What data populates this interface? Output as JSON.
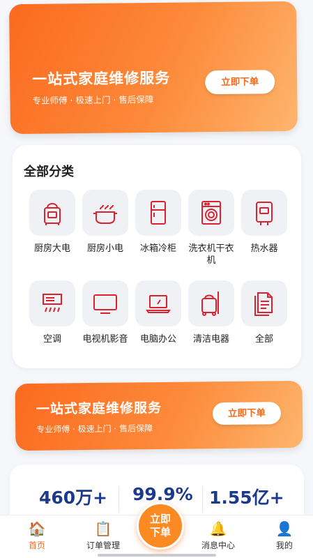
{
  "banner_top": {
    "title": "一站式家庭维修服务",
    "subtitle": "专业师傅 · 极速上门 · 售后保障",
    "button": "立即下单"
  },
  "categories": {
    "title": "全部分类",
    "items": [
      {
        "label": "厨房大电",
        "icon": "kitchen-appliance-icon"
      },
      {
        "label": "厨房小电",
        "icon": "cooking-pot-icon"
      },
      {
        "label": "冰箱冷柜",
        "icon": "refrigerator-icon"
      },
      {
        "label": "洗衣机干衣机",
        "icon": "washing-machine-icon"
      },
      {
        "label": "热水器",
        "icon": "water-heater-icon"
      },
      {
        "label": "空调",
        "icon": "air-conditioner-icon"
      },
      {
        "label": "电视机影音",
        "icon": "television-icon"
      },
      {
        "label": "电脑办公",
        "icon": "laptop-icon"
      },
      {
        "label": "清洁电器",
        "icon": "cleaning-appliance-icon"
      },
      {
        "label": "全部",
        "icon": "all-documents-icon"
      }
    ]
  },
  "banner_mid": {
    "title": "一站式家庭维修服务",
    "subtitle": "专业师傅 · 极速上门 · 售后保障",
    "button": "立即下单"
  },
  "stats": {
    "values": [
      "460万+",
      "99.9%",
      "1.55亿+"
    ]
  },
  "tabbar": {
    "items": [
      {
        "label": "首页",
        "icon": "home-icon",
        "active": true
      },
      {
        "label": "订单管理",
        "icon": "clipboard-icon",
        "active": false
      },
      {
        "label": "消息中心",
        "icon": "bell-icon",
        "active": false
      },
      {
        "label": "我的",
        "icon": "user-icon",
        "active": false
      }
    ],
    "fab_line1": "立即",
    "fab_line2": "下单"
  },
  "colors": {
    "accent": "#fb6a1f",
    "icon_red": "#d9232e",
    "stat_blue": "#1b3a8c"
  }
}
